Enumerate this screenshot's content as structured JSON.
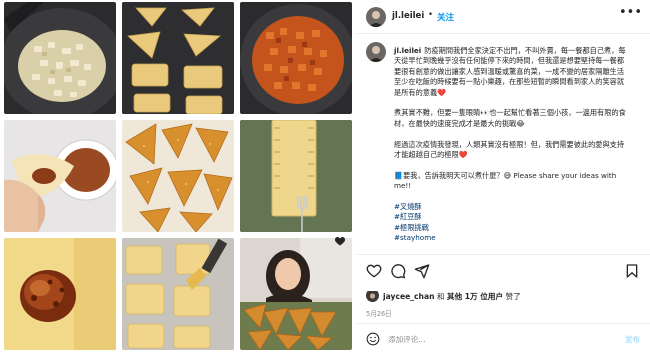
{
  "header": {
    "username": "jl.leilei",
    "separator": "•",
    "follow_label": "关注",
    "more_icon": "more-horizontal-icon"
  },
  "caption": {
    "username": "jl.leilei",
    "paragraphs": [
      "防疫期間我們全家決定不出門，不叫外賣，每一餐都自己煮，每天從早忙到晚幾乎沒有任何能停下來的時間，但我還是想要堅持每一餐都要很有創意的做出讓家人感到溫暖或驚喜的菜，一成不變的居家隔離生活至少在吃飯的時候要有一點小樂趣，在那些短暫的瞬間看到家人的笑容就是所有的意義❤️",
      "煮其實不難，但要一隻眼睛👀也一起幫忙看著三個小孩，一邊用有限的食材，在最快的速度完成才是最大的挑戰😂",
      "經過這次疫情我發現，人類其實沒有極限！但，我們需要彼此的愛與支持才能超越自己的極限❤️",
      "📘要我，告訴我明天可以煮什麼？😅 Please share your ideas with me!!"
    ],
    "hashtags": [
      "#叉燒酥",
      "#紅豆酥",
      "#極限挑戰",
      "#stayhome"
    ]
  },
  "actions": {
    "like_icon": "heart-icon",
    "comment_icon": "comment-icon",
    "share_icon": "share-icon",
    "save_icon": "bookmark-icon"
  },
  "likes": {
    "liker": "jaycee_chan",
    "connector": "和",
    "others": "其他 1万 位用户",
    "suffix": "赞了"
  },
  "date": "5月26日",
  "comment": {
    "emoji_icon": "smiley-icon",
    "placeholder": "添加评论...",
    "post_label": "发布"
  },
  "colors": {
    "accent": "#0095f6",
    "hashtag": "#00376b",
    "muted": "#8e8e8e",
    "post_disabled": "#b2dffc",
    "border": "#efefef"
  }
}
